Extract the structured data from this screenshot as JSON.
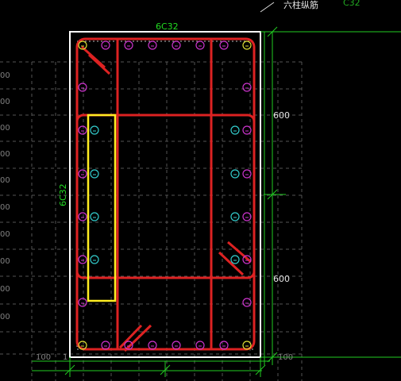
{
  "labels": {
    "top_rebar": "6C32",
    "left_rebar": "6C32",
    "top_right_partial_zh": "六柱纵筋",
    "top_right_partial_code": "C32"
  },
  "dimensions": {
    "right_upper": "600",
    "right_lower": "600",
    "right_bottom": "100",
    "bottom_left": "100",
    "bottom_left_partial": "1"
  },
  "grid_labels": [
    "00",
    "00",
    "00",
    "00",
    "00",
    "00",
    "00",
    "00",
    "00",
    "00",
    "00"
  ],
  "colors": {
    "background": "#000000",
    "section_outline": "#ffffff",
    "stirrup": "#dd2222",
    "rebar_magenta": "#cc33cc",
    "rebar_cyan": "#33cccc",
    "rebar_yellow": "#dddd33",
    "highlight": "#ffee22",
    "dimension_line": "#22cc22",
    "grid": "#555555"
  }
}
